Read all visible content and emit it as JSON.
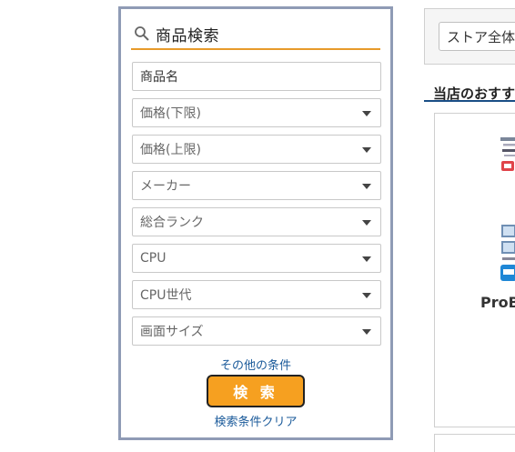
{
  "search_panel": {
    "title": "商品検索",
    "fields": [
      {
        "label": "商品名",
        "type": "text"
      },
      {
        "label": "価格(下限)",
        "type": "select"
      },
      {
        "label": "価格(上限)",
        "type": "select"
      },
      {
        "label": "メーカー",
        "type": "select"
      },
      {
        "label": "総合ランク",
        "type": "select"
      },
      {
        "label": "CPU",
        "type": "select"
      },
      {
        "label": "CPU世代",
        "type": "select"
      },
      {
        "label": "画面サイズ",
        "type": "select"
      }
    ],
    "other_conditions_link": "その他の条件",
    "search_button": "検 索",
    "clear_link": "検索条件クリア"
  },
  "store_scope": {
    "value": "ストア全体"
  },
  "recommend": {
    "section_title": "当店のおすす",
    "product_name_partial": "ProB"
  },
  "colors": {
    "accent": "#f6a020",
    "panel_border": "#8f9bb5",
    "link": "#1a5a9a",
    "underline": "#e79a2a"
  }
}
